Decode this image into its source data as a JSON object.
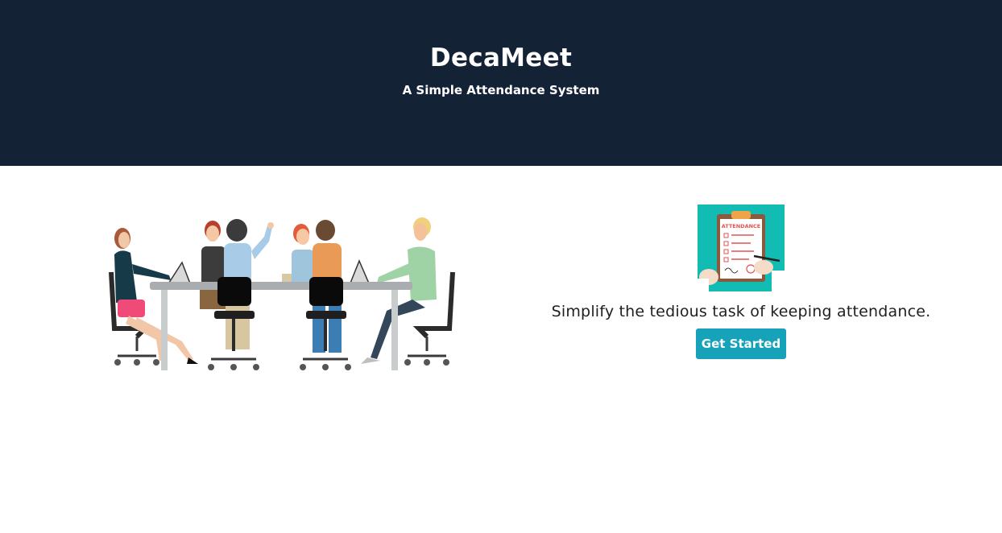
{
  "hero": {
    "title": "DecaMeet",
    "subtitle": "A Simple Attendance System",
    "background_color": "#142236"
  },
  "main": {
    "illustration": {
      "name": "team-meeting-illustration"
    },
    "clipboard_image": {
      "name": "attendance-clipboard-illustration",
      "caption": "ATTENDANCE"
    },
    "tagline": "Simplify the tedious task of keeping attendance.",
    "cta_label": "Get Started",
    "accent_color": "#16a2b8"
  }
}
